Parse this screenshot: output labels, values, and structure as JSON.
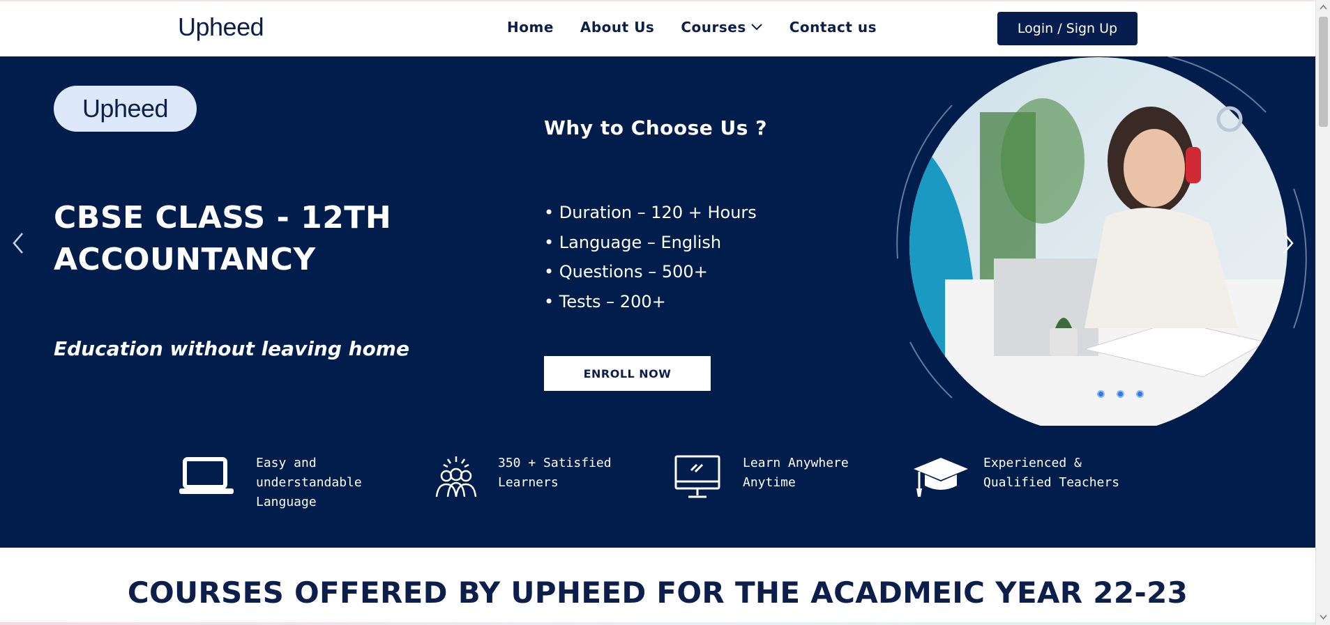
{
  "header": {
    "logo": "Upheed",
    "nav": [
      {
        "label": "Home"
      },
      {
        "label": "About Us"
      },
      {
        "label": "Courses"
      },
      {
        "label": "Contact us"
      }
    ],
    "login_label": "Login / Sign Up"
  },
  "hero": {
    "logo": "Upheed",
    "title_line1": "CBSE CLASS - 12TH",
    "title_line2": "ACCOUNTANCY",
    "tagline": "Education without leaving home",
    "why_title": "Why to Choose Us ?",
    "features": [
      "• Duration – 120 + Hours",
      "• Language – English",
      "• Questions – 500+",
      "• Tests – 200+"
    ],
    "enroll_label": "ENROLL NOW",
    "slide_count": 3
  },
  "highlights": [
    {
      "icon": "laptop-icon",
      "lines": [
        "Easy and",
        "understandable",
        "Language"
      ]
    },
    {
      "icon": "learners-group-icon",
      "lines": [
        "350 + Satisfied",
        "Learners"
      ]
    },
    {
      "icon": "monitor-icon",
      "lines": [
        "Learn Anywhere",
        "Anytime"
      ]
    },
    {
      "icon": "graduation-cap-icon",
      "lines": [
        "Experienced &",
        "Qualified Teachers"
      ]
    }
  ],
  "courses": {
    "heading": "COURSES OFFERED BY UPHEED FOR THE ACADMEIC YEAR 22-23"
  },
  "colors": {
    "navy": "#011d4b",
    "button_navy": "#061d4d",
    "white": "#ffffff",
    "dot_blue": "#2b7be0"
  }
}
